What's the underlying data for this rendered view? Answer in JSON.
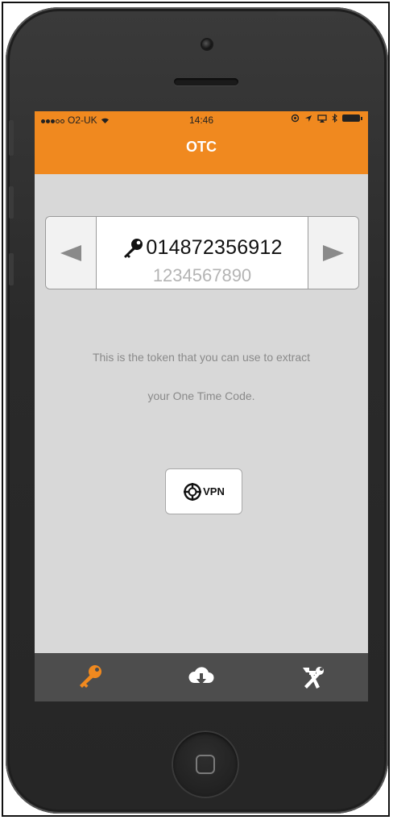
{
  "status_bar": {
    "carrier": "O2-UK",
    "time": "14:46"
  },
  "header": {
    "title": "OTC"
  },
  "token": {
    "current": "014872356912",
    "next": "1234567890"
  },
  "description": {
    "line1": "This is the token that you can use to extract",
    "line2": "your One Time Code."
  },
  "vpn_button": {
    "label": "VPN"
  },
  "tab_bar": {
    "tabs": [
      {
        "icon": "key-icon",
        "active": true
      },
      {
        "icon": "cloud-download-icon",
        "active": false
      },
      {
        "icon": "tools-icon",
        "active": false
      }
    ]
  },
  "colors": {
    "accent": "#f0891f",
    "screen_bg": "#d8d8d8",
    "tabbar_bg": "#4d4d4d"
  }
}
